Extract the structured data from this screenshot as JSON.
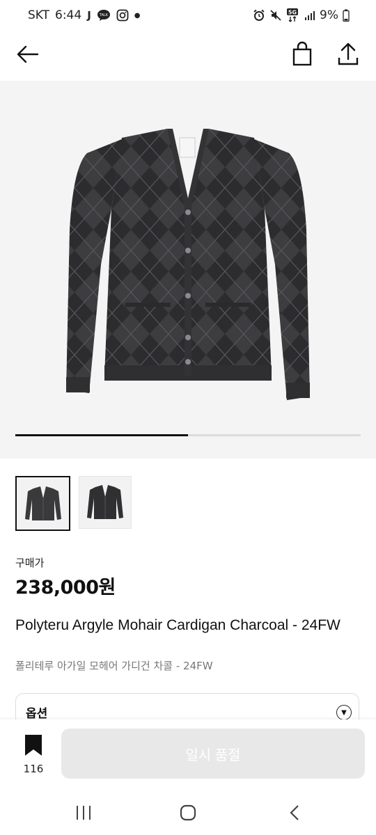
{
  "status_bar": {
    "carrier": "SKT",
    "time": "6:44",
    "battery": "9%"
  },
  "top_bar": {
    "back_icon": "arrow-left-icon",
    "bag_icon": "shopping-bag-icon",
    "share_icon": "share-icon"
  },
  "gallery": {
    "image_count": 2,
    "current_index": 1,
    "progress_fraction": 0.5
  },
  "product": {
    "price_label": "구매가",
    "price": "238,000원",
    "title": "Polyteru Argyle Mohair Cardigan Charcoal - 24FW",
    "subtitle": "폴리테루 아가일 모헤어 가디건 차콜 - 24FW"
  },
  "options": {
    "label": "옵션"
  },
  "bottom_bar": {
    "bookmark_count": "116",
    "cta_label": "일시 품절"
  },
  "colors": {
    "cta_background": "#e8e8e8",
    "hero_background": "#f4f4f4",
    "cardigan": "#3a3a3c"
  }
}
